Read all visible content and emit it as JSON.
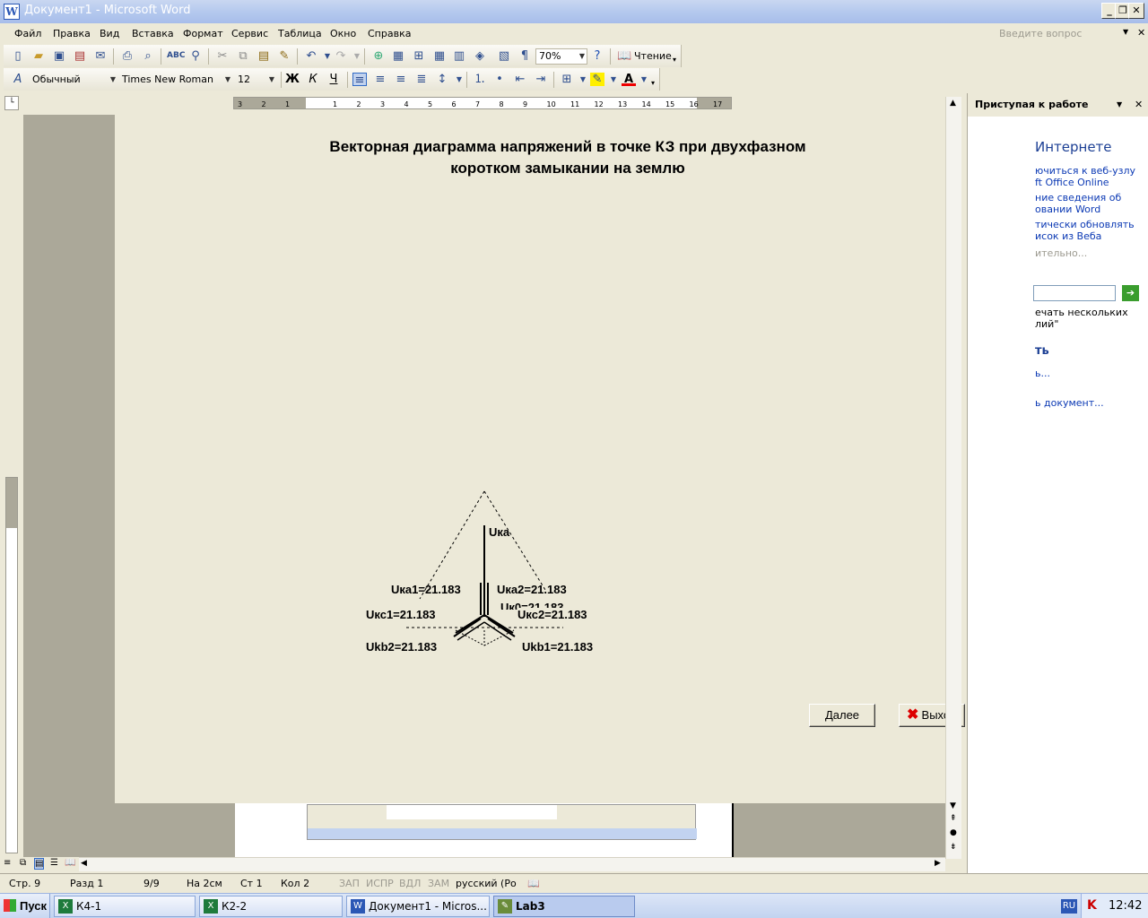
{
  "window": {
    "title": "Документ1 - Microsoft Word"
  },
  "menu": {
    "items": [
      "Файл",
      "Правка",
      "Вид",
      "Вставка",
      "Формат",
      "Сервис",
      "Таблица",
      "Окно",
      "Справка"
    ],
    "ask_placeholder": "Введите вопрос"
  },
  "toolbar": {
    "zoom": "70%",
    "reading_label": "Чтение",
    "style": "Обычный",
    "font": "Times New Roman",
    "size": "12",
    "bold": "Ж",
    "italic": "К",
    "underline": "Ч"
  },
  "ruler": {
    "h_labels": [
      "3",
      "2",
      "1",
      "1",
      "2",
      "3",
      "4",
      "5",
      "6",
      "7",
      "8",
      "9",
      "10",
      "11",
      "12",
      "13",
      "14",
      "15",
      "16",
      "17"
    ]
  },
  "dialog": {
    "title_line1": "Векторная диаграмма напряжений в точке КЗ при двухфазном",
    "title_line2": "коротком замыкании на землю",
    "labels": {
      "uka": "Uка",
      "uka1": "Uка1=21.183",
      "uka2": "Uка2=21.183",
      "ukc1": "Uкс1=21.183",
      "ukc2": "Uкс2=21.183",
      "uk0": "Uк0=21.183",
      "ukb2": "Ukb2=21.183",
      "ukb1": "Ukb1=21.183"
    },
    "next_label": "Далее",
    "exit_label": "Выход"
  },
  "taskpane": {
    "title": "Приступая к работе",
    "heading1": "Интернете",
    "links": [
      "ючиться к веб-узлу",
      "ft Office Online",
      "ние сведения об",
      "овании Word",
      "тически обновлять",
      "исок из Веба"
    ],
    "more": "ительно...",
    "hint1": "ечать нескольких",
    "hint2": "лий\"",
    "heading2": "ть",
    "link_open": "ь...",
    "link_doc": "ь документ..."
  },
  "status": {
    "page": "Стр. 9",
    "section": "Разд 1",
    "pages": "9/9",
    "at": "На 2см",
    "line": "Ст 1",
    "col": "Кол 2",
    "rec": "ЗАП",
    "trk": "ИСПР",
    "ext": "ВДЛ",
    "ovr": "ЗАМ",
    "lang": "русский (Ро"
  },
  "taskbar": {
    "start": "Пуск",
    "tasks": [
      "К4-1",
      "К2-2",
      "Документ1 - Micros...",
      "Lab3"
    ],
    "lang": "RU",
    "clock": "12:42"
  }
}
